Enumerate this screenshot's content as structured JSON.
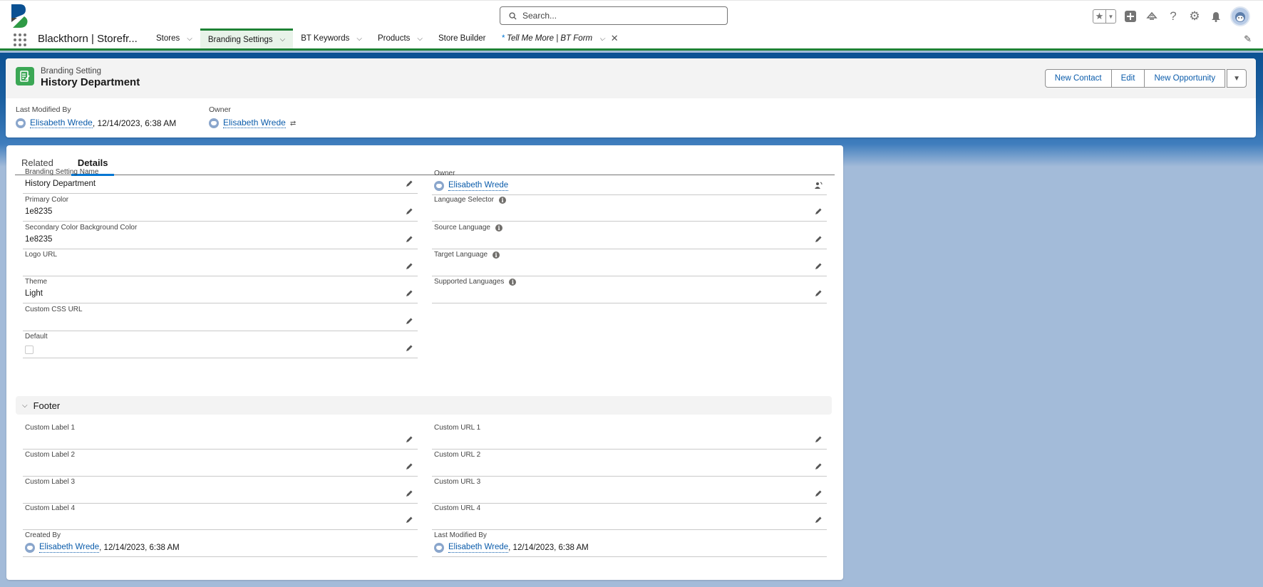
{
  "header": {
    "search_placeholder": "Search...",
    "icons": [
      "favorites-star-icon",
      "favorites-dropdown-icon",
      "global-actions-plus-icon",
      "trailhead-guidance-icon",
      "help-question-icon",
      "setup-gear-icon",
      "notifications-bell-icon",
      "user-avatar-icon"
    ]
  },
  "nav": {
    "app_name": "Blackthorn | Storefr...",
    "items": [
      {
        "label": "Stores",
        "has_menu": true
      },
      {
        "label": "Branding Settings",
        "has_menu": true,
        "active": true
      },
      {
        "label": "BT Keywords",
        "has_menu": true
      },
      {
        "label": "Products",
        "has_menu": true
      },
      {
        "label": "Store Builder",
        "has_menu": false
      },
      {
        "label": "Tell Me More | BT Form",
        "has_menu": true,
        "unsaved_marker": "*",
        "closable": true
      }
    ]
  },
  "record": {
    "object_type": "Branding Setting",
    "title": "History Department",
    "actions": [
      "New Contact",
      "Edit",
      "New Opportunity"
    ],
    "highlights": {
      "last_modified_label": "Last Modified By",
      "last_modified_user": "Elisabeth Wrede",
      "last_modified_date": ", 12/14/2023, 6:38 AM",
      "owner_label": "Owner",
      "owner_user": "Elisabeth Wrede"
    }
  },
  "tabs": [
    {
      "label": "Related",
      "active": false
    },
    {
      "label": "Details",
      "active": true
    }
  ],
  "details": {
    "left": [
      {
        "label": "Branding Setting Name",
        "value": "History Department"
      },
      {
        "label": "Primary Color",
        "value": "1e8235"
      },
      {
        "label": "Secondary Color Background Color",
        "value": "1e8235"
      },
      {
        "label": "Logo URL",
        "value": ""
      },
      {
        "label": "Theme",
        "value": "Light"
      },
      {
        "label": "Custom CSS URL",
        "value": ""
      },
      {
        "label": "Default",
        "value": "",
        "checkbox": false
      }
    ],
    "right": [
      {
        "label": "Owner",
        "user": "Elisabeth Wrede"
      },
      {
        "label": "Language Selector",
        "value": "",
        "info": true
      },
      {
        "label": "Source Language",
        "value": "",
        "info": true
      },
      {
        "label": "Target Language",
        "value": "",
        "info": true
      },
      {
        "label": "Supported Languages",
        "value": "",
        "info": true
      }
    ]
  },
  "footer_section": {
    "title": "Footer",
    "left": [
      {
        "label": "Custom Label 1",
        "value": ""
      },
      {
        "label": "Custom Label 2",
        "value": ""
      },
      {
        "label": "Custom Label 3",
        "value": ""
      },
      {
        "label": "Custom Label 4",
        "value": ""
      }
    ],
    "right": [
      {
        "label": "Custom URL 1",
        "value": ""
      },
      {
        "label": "Custom URL 2",
        "value": ""
      },
      {
        "label": "Custom URL 3",
        "value": ""
      },
      {
        "label": "Custom URL 4",
        "value": ""
      }
    ],
    "created_by": {
      "label": "Created By",
      "user": "Elisabeth Wrede",
      "date": ", 12/14/2023, 6:38 AM"
    },
    "last_modified_by": {
      "label": "Last Modified By",
      "user": "Elisabeth Wrede",
      "date": ", 12/14/2023, 6:38 AM"
    }
  },
  "colors": {
    "brand_green": "#1e8235",
    "link_blue": "#0b5cab",
    "tab_underline": "#0176d3",
    "object_icon": "#3ba755"
  }
}
